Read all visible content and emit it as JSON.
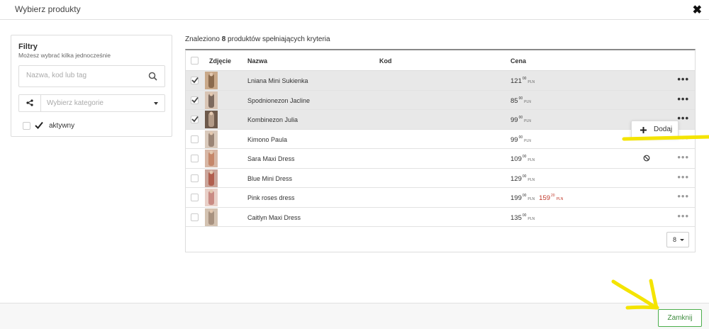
{
  "modal": {
    "title": "Wybierz produkty",
    "close_icon": "close-x-icon"
  },
  "filters": {
    "title": "Filtry",
    "subtitle": "Możesz wybrać kilka jednocześnie",
    "search_placeholder": "Nazwa, kod lub tag",
    "category_placeholder": "Wybierz kategorie",
    "active_label": "aktywny"
  },
  "results": {
    "prefix": "Znaleziono",
    "count": "8",
    "suffix": "produktów spełniających kryteria"
  },
  "table": {
    "headers": {
      "photo": "Zdjęcie",
      "name": "Nazwa",
      "code": "Kod",
      "price": "Cena"
    },
    "rows": [
      {
        "name": "Lniana Mini Sukienka",
        "price": "121",
        "cents": "00",
        "currency": "PLN",
        "selected": true
      },
      {
        "name": "Spodnionezon Jacline",
        "price": "85",
        "cents": "00",
        "currency": "PLN",
        "selected": true
      },
      {
        "name": "Kombinezon Julia",
        "price": "99",
        "cents": "00",
        "currency": "PLN",
        "selected": true
      },
      {
        "name": "Kimono Paula",
        "price": "99",
        "cents": "00",
        "currency": "PLN",
        "selected": false
      },
      {
        "name": "Sara Maxi Dress",
        "price": "109",
        "cents": "00",
        "currency": "PLN",
        "selected": false
      },
      {
        "name": "Blue Mini Dress",
        "price": "129",
        "cents": "00",
        "currency": "PLN",
        "selected": false
      },
      {
        "name": "Pink roses dress",
        "price": "199",
        "cents": "00",
        "currency": "PLN",
        "old_price": "159",
        "old_cents": "20",
        "old_currency": "PLN",
        "selected": false
      },
      {
        "name": "Caitlyn Maxi Dress",
        "price": "135",
        "cents": "00",
        "currency": "PLN",
        "selected": false
      }
    ],
    "per_page": "8"
  },
  "popup": {
    "add_label": "Dodaj"
  },
  "footer": {
    "close_label": "Zamknij"
  },
  "colors": {
    "accent_green": "#4cae4c",
    "sale_red": "#c0392b",
    "annotation_yellow": "#f4e400"
  }
}
